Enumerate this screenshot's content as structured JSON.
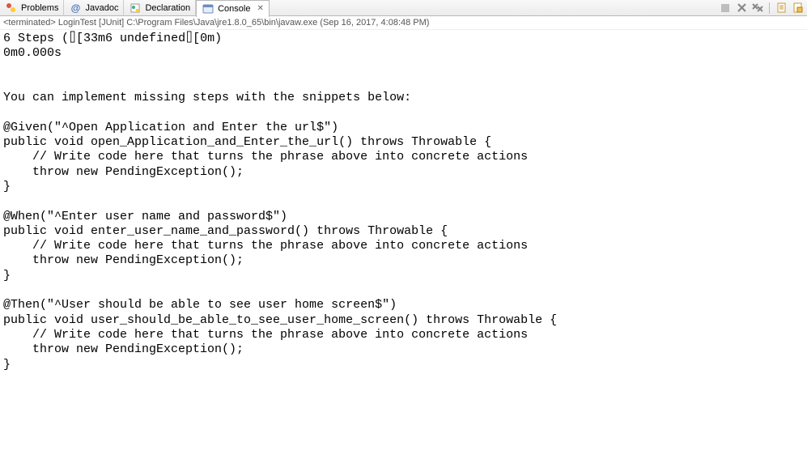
{
  "tabs": {
    "problems": {
      "label": "Problems"
    },
    "javadoc": {
      "label": "Javadoc"
    },
    "declaration": {
      "label": "Declaration"
    },
    "console": {
      "label": "Console"
    }
  },
  "console_header": "<terminated> LoginTest [JUnit] C:\\Program Files\\Java\\jre1.8.0_65\\bin\\javaw.exe (Sep 16, 2017, 4:08:48 PM)",
  "console_output": "6 Steps (⌷[33m6 undefined⌷[0m)\n0m0.000s\n\n\nYou can implement missing steps with the snippets below:\n\n@Given(\"^Open Application and Enter the url$\")\npublic void open_Application_and_Enter_the_url() throws Throwable {\n    // Write code here that turns the phrase above into concrete actions\n    throw new PendingException();\n}\n\n@When(\"^Enter user name and password$\")\npublic void enter_user_name_and_password() throws Throwable {\n    // Write code here that turns the phrase above into concrete actions\n    throw new PendingException();\n}\n\n@Then(\"^User should be able to see user home screen$\")\npublic void user_should_be_able_to_see_user_home_screen() throws Throwable {\n    // Write code here that turns the phrase above into concrete actions\n    throw new PendingException();\n}"
}
